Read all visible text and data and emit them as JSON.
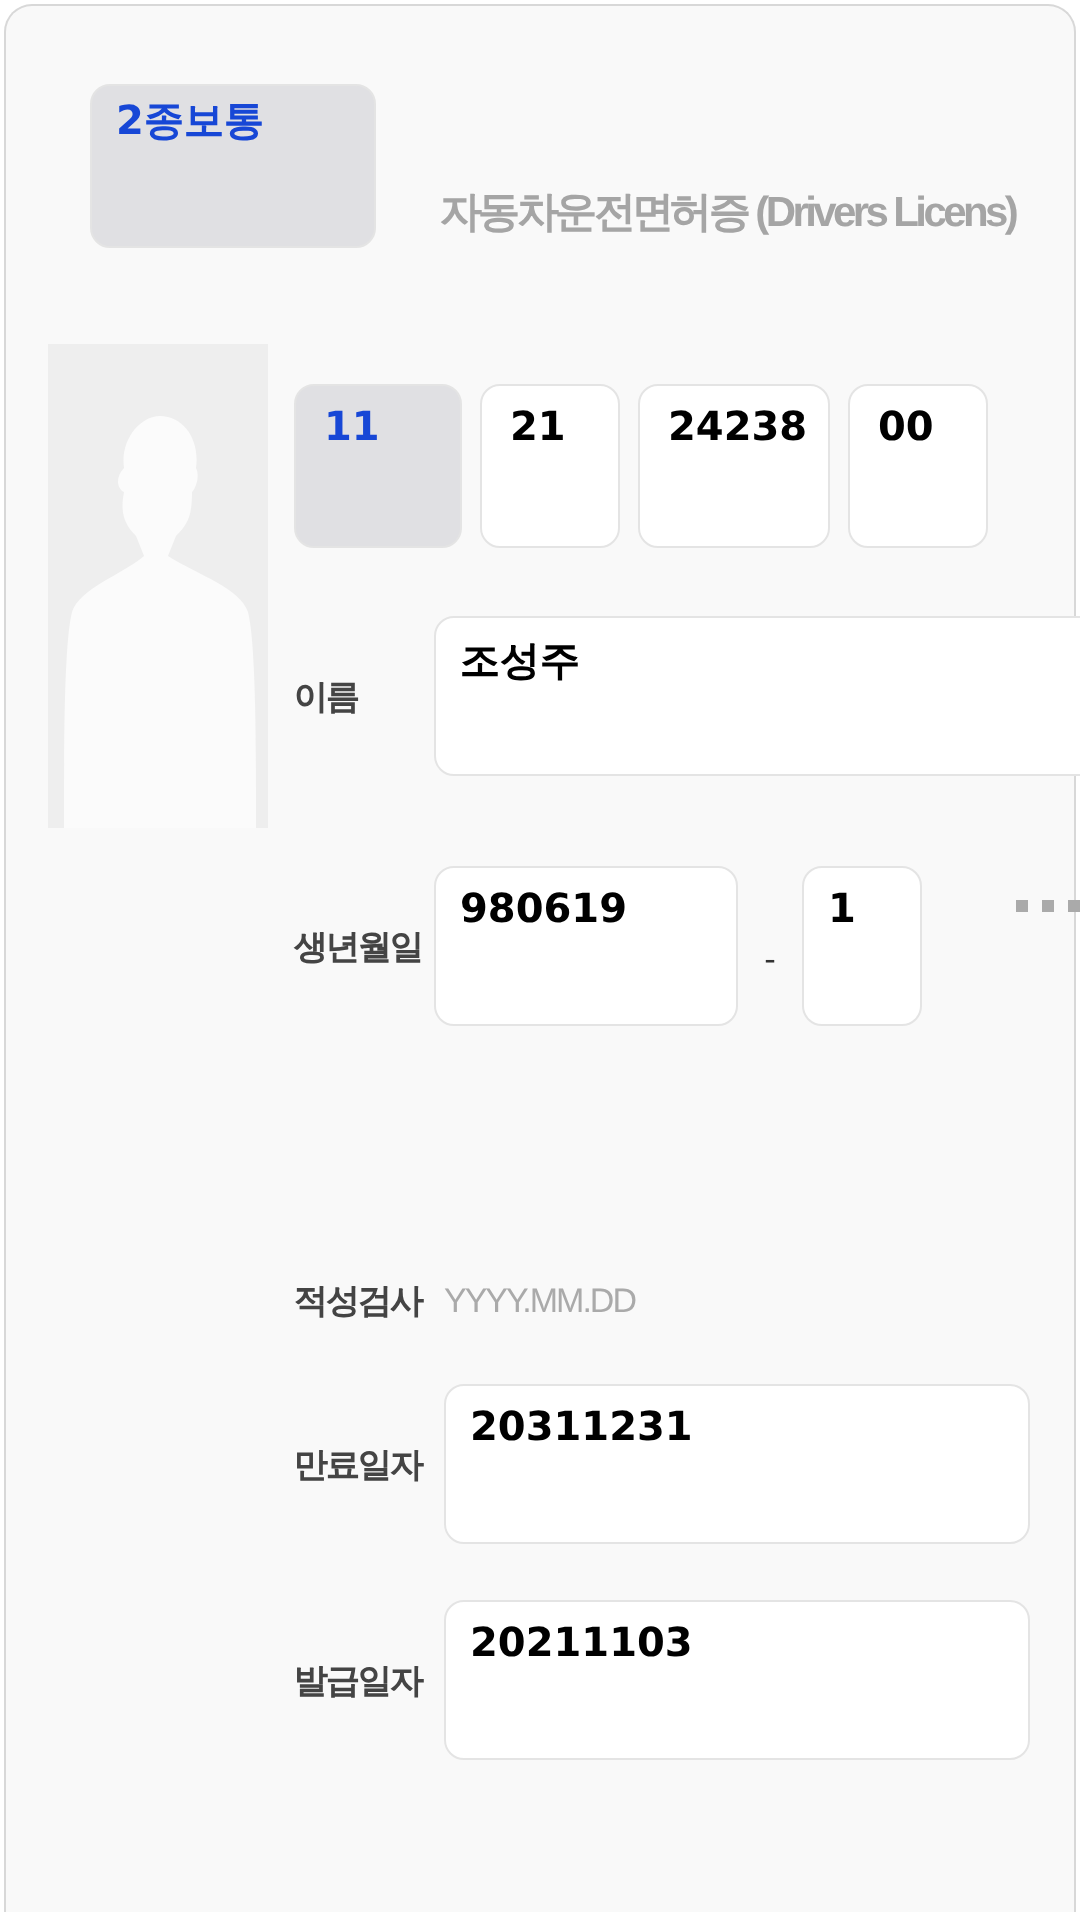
{
  "license_type": {
    "value": "2종보통",
    "disabled": true
  },
  "title": "자동차운전면허증 (Drivers Licens)",
  "license_number": [
    {
      "value": "11",
      "disabled": true
    },
    {
      "value": "21",
      "disabled": false
    },
    {
      "value": "24238",
      "disabled": false
    },
    {
      "value": "00",
      "disabled": false
    }
  ],
  "id_fields": [
    {
      "label": "이름",
      "kind": "text",
      "value": "조성주"
    },
    {
      "label": "생년월일",
      "kind": "split",
      "value": "980619",
      "separator": "-",
      "suffix": "1"
    }
  ],
  "date_fields": [
    {
      "label": "적성검사",
      "kind": "placeholder",
      "placeholder": "YYYY.MM.DD"
    },
    {
      "label": "만료일자",
      "kind": "text",
      "value": "20311231"
    },
    {
      "label": "발급일자",
      "kind": "text",
      "value": "20211103"
    }
  ]
}
